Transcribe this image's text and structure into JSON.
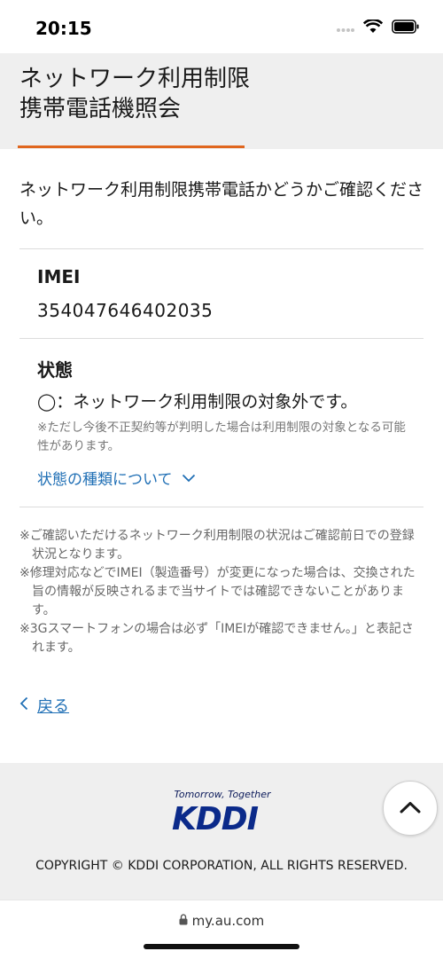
{
  "status_bar": {
    "time": "20:15"
  },
  "header": {
    "title_line1": "ネットワーク利用制限",
    "title_line2": "携帯電話機照会"
  },
  "intro": "ネットワーク利用制限携帯電話かどうかご確認ください。",
  "imei": {
    "label": "IMEI",
    "value": "354047646402035"
  },
  "status": {
    "label": "状態",
    "value": "◯：ネットワーク利用制限の対象外です。",
    "note": "※ただし今後不正契約等が判明した場合は利用制限の対象となる可能性があります。",
    "link": "状態の種類について"
  },
  "notes": [
    "※ご確認いただけるネットワーク利用制限の状況はご確認前日での登録状況となります。",
    "※修理対応などでIMEI（製造番号）が変更になった場合は、交換された旨の情報が反映されるまで当サイトでは確認できないことがあります。",
    "※3Gスマートフォンの場合は必ず「IMEIが確認できません。」と表記されます。"
  ],
  "back_label": "戻る",
  "footer": {
    "tagline": "Tomorrow, Together",
    "logo_text": "KDDI",
    "copyright": "COPYRIGHT © KDDI CORPORATION, ALL RIGHTS RESERVED."
  },
  "browser": {
    "url": "my.au.com"
  },
  "colors": {
    "accent": "#e0661e",
    "link": "#1f6fb5",
    "brand": "#0b2a8a"
  }
}
